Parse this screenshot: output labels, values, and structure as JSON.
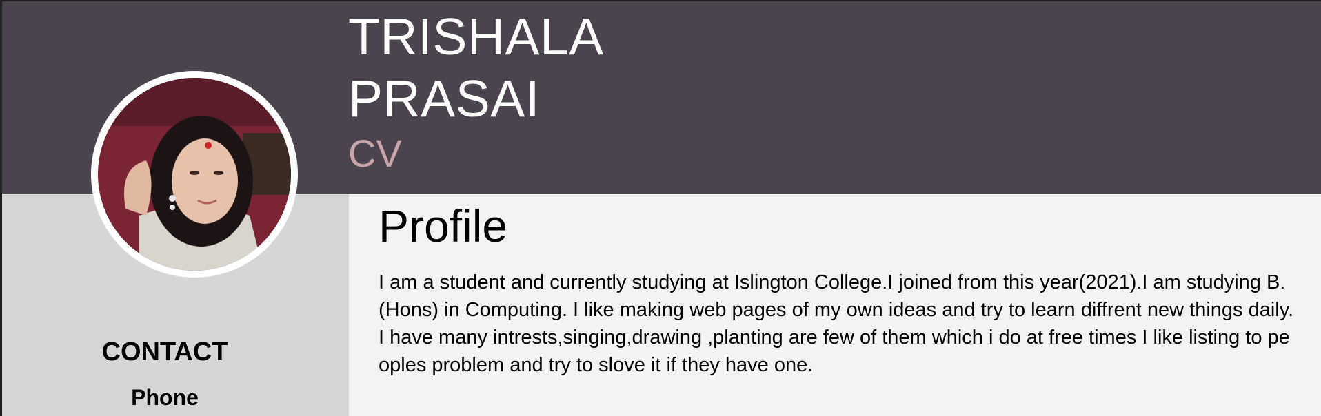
{
  "header": {
    "first_name": "TRISHALA",
    "last_name": "PRASAI",
    "doc_label": "CV"
  },
  "sidebar": {
    "contact_title": "CONTACT",
    "phone_label": "Phone"
  },
  "profile": {
    "title": "Profile",
    "text": "I am a student and currently studying at Islington College.I joined from this year(2021).I am studying B.(Hons) in Computing. I like making web pages of my own ideas and try to learn diffrent new things daily. I have many intrests,singing,drawing ,planting are few of them which i do at free times I like listing to peoples problem and try to slove it if they have one."
  },
  "colors": {
    "header_bg": "#4b434d",
    "sidebar_bg": "#d6d6d6",
    "content_bg": "#f3f3f3",
    "accent": "#c8a6a8"
  }
}
